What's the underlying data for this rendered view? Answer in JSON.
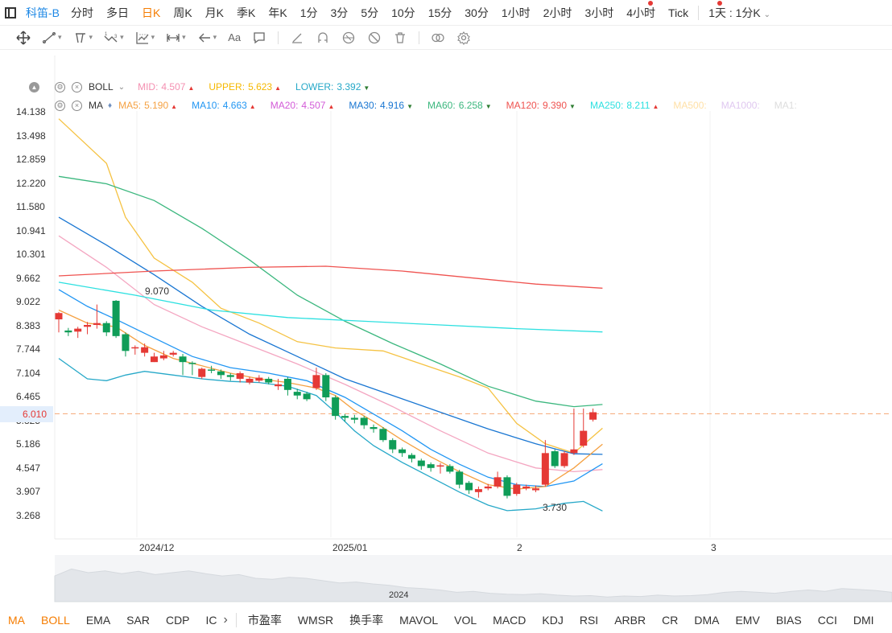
{
  "symbol": "科笛-B",
  "periods": [
    "分时",
    "多日",
    "日K",
    "周K",
    "月K",
    "季K",
    "年K",
    "1分",
    "3分",
    "5分",
    "10分",
    "15分",
    "30分",
    "1小时",
    "2小时",
    "3小时",
    "4小时",
    "Tick"
  ],
  "active_period": "日K",
  "interval_select": "1天 : 1分K",
  "toolbar": {
    "text_tool_label": "Aa"
  },
  "boll": {
    "name": "BOLL",
    "items": [
      {
        "label": "MID:",
        "value": "4.507",
        "color": "#f48fb1",
        "dir": "up"
      },
      {
        "label": "UPPER:",
        "value": "5.623",
        "color": "#f5b800",
        "dir": "up"
      },
      {
        "label": "LOWER:",
        "value": "3.392",
        "color": "#26a8c8",
        "dir": "down"
      }
    ]
  },
  "ma": {
    "name": "MA",
    "items": [
      {
        "label": "MA5:",
        "value": "5.190",
        "color": "#f5a142",
        "dir": "up"
      },
      {
        "label": "MA10:",
        "value": "4.663",
        "color": "#2196f3",
        "dir": "up"
      },
      {
        "label": "MA20:",
        "value": "4.507",
        "color": "#d35bd8",
        "dir": "up"
      },
      {
        "label": "MA30:",
        "value": "4.916",
        "color": "#1976d2",
        "dir": "down"
      },
      {
        "label": "MA60:",
        "value": "6.258",
        "color": "#3bb77e",
        "dir": "down"
      },
      {
        "label": "MA120:",
        "value": "9.390",
        "color": "#ef5350",
        "dir": "down"
      },
      {
        "label": "MA250:",
        "value": "8.211",
        "color": "#2ce0e0",
        "dir": "up"
      },
      {
        "label": "MA500:",
        "value": "",
        "color": "#ffe0a6",
        "dir": ""
      },
      {
        "label": "MA1000:",
        "value": "",
        "color": "#e0c8f0",
        "dir": ""
      },
      {
        "label": "MA1:",
        "value": "",
        "color": "#dddddd",
        "dir": ""
      }
    ]
  },
  "price_ticks": [
    "14.138",
    "13.498",
    "12.859",
    "12.220",
    "11.580",
    "10.941",
    "10.301",
    "9.662",
    "9.022",
    "8.383",
    "7.744",
    "7.104",
    "6.465",
    "5.825",
    "5.186",
    "4.547",
    "3.907",
    "3.268"
  ],
  "current_price": "6.010",
  "annotations": {
    "high": "9.070",
    "low": "3.730"
  },
  "x_labels": [
    "2024/12",
    "2025/01",
    "2",
    "3"
  ],
  "navigator_label": "2024",
  "indicator_tabs": [
    "MA",
    "BOLL",
    "EMA",
    "SAR",
    "CDP",
    "IC",
    "市盈率",
    "WMSR",
    "换手率",
    "MAVOL",
    "VOL",
    "MACD",
    "KDJ",
    "RSI",
    "ARBR",
    "CR",
    "DMA",
    "EMV",
    "BIAS",
    "CCI",
    "DMI"
  ],
  "active_indicators": [
    "MA",
    "BOLL"
  ],
  "colors": {
    "up": "#e53935",
    "down": "#0f9d58",
    "accent": "#f57c00",
    "link": "#1e88e5"
  },
  "chart_data": {
    "type": "candlestick",
    "price_ylim": [
      3.268,
      14.138
    ],
    "candles": [
      {
        "o": 8.55,
        "c": 8.72,
        "h": 8.75,
        "l": 8.2
      },
      {
        "o": 8.25,
        "c": 8.2,
        "h": 8.32,
        "l": 8.1
      },
      {
        "o": 8.22,
        "c": 8.3,
        "h": 8.35,
        "l": 8.05
      },
      {
        "o": 8.35,
        "c": 8.4,
        "h": 8.48,
        "l": 8.15
      },
      {
        "o": 8.4,
        "c": 8.45,
        "h": 8.95,
        "l": 8.3
      },
      {
        "o": 8.45,
        "c": 8.2,
        "h": 8.5,
        "l": 8.1
      },
      {
        "o": 9.05,
        "c": 8.1,
        "h": 9.07,
        "l": 8.05
      },
      {
        "o": 8.15,
        "c": 7.7,
        "h": 8.2,
        "l": 7.55
      },
      {
        "o": 7.78,
        "c": 7.8,
        "h": 7.85,
        "l": 7.6
      },
      {
        "o": 7.65,
        "c": 7.8,
        "h": 7.9,
        "l": 7.55
      },
      {
        "o": 7.4,
        "c": 7.55,
        "h": 7.65,
        "l": 7.4
      },
      {
        "o": 7.5,
        "c": 7.58,
        "h": 7.7,
        "l": 7.45
      },
      {
        "o": 7.6,
        "c": 7.65,
        "h": 7.7,
        "l": 7.55
      },
      {
        "o": 7.55,
        "c": 7.4,
        "h": 7.62,
        "l": 7.05
      },
      {
        "o": 7.38,
        "c": 7.35,
        "h": 7.42,
        "l": 7.05
      },
      {
        "o": 7.0,
        "c": 7.22,
        "h": 7.25,
        "l": 6.95
      },
      {
        "o": 7.2,
        "c": 7.18,
        "h": 7.3,
        "l": 7.1
      },
      {
        "o": 7.15,
        "c": 7.05,
        "h": 7.2,
        "l": 6.95
      },
      {
        "o": 7.05,
        "c": 7.0,
        "h": 7.1,
        "l": 6.9
      },
      {
        "o": 6.95,
        "c": 7.1,
        "h": 7.15,
        "l": 6.85
      },
      {
        "o": 6.85,
        "c": 6.95,
        "h": 7.0,
        "l": 6.8
      },
      {
        "o": 6.9,
        "c": 6.98,
        "h": 7.05,
        "l": 6.85
      },
      {
        "o": 6.95,
        "c": 6.85,
        "h": 7.0,
        "l": 6.8
      },
      {
        "o": 6.75,
        "c": 6.8,
        "h": 6.95,
        "l": 6.65
      },
      {
        "o": 6.95,
        "c": 6.65,
        "h": 7.0,
        "l": 6.5
      },
      {
        "o": 6.6,
        "c": 6.5,
        "h": 6.68,
        "l": 6.4
      },
      {
        "o": 6.55,
        "c": 6.4,
        "h": 6.6,
        "l": 6.35
      },
      {
        "o": 6.7,
        "c": 7.05,
        "h": 7.25,
        "l": 6.65
      },
      {
        "o": 7.05,
        "c": 6.45,
        "h": 7.1,
        "l": 6.35
      },
      {
        "o": 6.45,
        "c": 5.95,
        "h": 6.5,
        "l": 5.85
      },
      {
        "o": 5.95,
        "c": 5.9,
        "h": 6.0,
        "l": 5.8
      },
      {
        "o": 5.9,
        "c": 5.85,
        "h": 5.98,
        "l": 5.75
      },
      {
        "o": 5.9,
        "c": 5.7,
        "h": 5.95,
        "l": 5.6
      },
      {
        "o": 5.65,
        "c": 5.6,
        "h": 5.72,
        "l": 5.5
      },
      {
        "o": 5.6,
        "c": 5.3,
        "h": 5.65,
        "l": 5.25
      },
      {
        "o": 5.3,
        "c": 5.05,
        "h": 5.35,
        "l": 4.95
      },
      {
        "o": 5.05,
        "c": 4.95,
        "h": 5.1,
        "l": 4.85
      },
      {
        "o": 4.9,
        "c": 4.8,
        "h": 4.95,
        "l": 4.7
      },
      {
        "o": 4.75,
        "c": 4.6,
        "h": 4.8,
        "l": 4.5
      },
      {
        "o": 4.65,
        "c": 4.55,
        "h": 4.7,
        "l": 4.45
      },
      {
        "o": 4.6,
        "c": 4.62,
        "h": 4.68,
        "l": 4.4
      },
      {
        "o": 4.6,
        "c": 4.45,
        "h": 4.65,
        "l": 4.4
      },
      {
        "o": 4.45,
        "c": 4.1,
        "h": 4.5,
        "l": 4.0
      },
      {
        "o": 4.15,
        "c": 3.95,
        "h": 4.2,
        "l": 3.85
      },
      {
        "o": 3.9,
        "c": 3.98,
        "h": 4.05,
        "l": 3.75
      },
      {
        "o": 4.0,
        "c": 4.05,
        "h": 4.12,
        "l": 3.95
      },
      {
        "o": 4.05,
        "c": 4.3,
        "h": 4.45,
        "l": 4.0
      },
      {
        "o": 4.3,
        "c": 3.8,
        "h": 4.35,
        "l": 3.73
      },
      {
        "o": 3.85,
        "c": 4.1,
        "h": 4.15,
        "l": 3.8
      },
      {
        "o": 4.0,
        "c": 4.05,
        "h": 4.1,
        "l": 3.95
      },
      {
        "o": 3.95,
        "c": 4.0,
        "h": 4.08,
        "l": 3.9
      },
      {
        "o": 4.1,
        "c": 4.95,
        "h": 5.3,
        "l": 4.05
      },
      {
        "o": 5.0,
        "c": 4.6,
        "h": 5.05,
        "l": 4.55
      },
      {
        "o": 4.6,
        "c": 4.95,
        "h": 5.0,
        "l": 4.55
      },
      {
        "o": 4.95,
        "c": 5.05,
        "h": 6.15,
        "l": 4.9
      },
      {
        "o": 5.15,
        "c": 5.55,
        "h": 6.15,
        "l": 5.1
      },
      {
        "o": 5.85,
        "c": 6.05,
        "h": 6.15,
        "l": 5.8
      }
    ],
    "series": [
      {
        "name": "BOLL UPPER",
        "color": "#f5c242",
        "values": [
          [
            0,
            13.95
          ],
          [
            5,
            12.75
          ],
          [
            7,
            11.3
          ],
          [
            10,
            10.2
          ],
          [
            14,
            9.55
          ],
          [
            17,
            8.85
          ],
          [
            21,
            8.45
          ],
          [
            25,
            7.95
          ],
          [
            29,
            7.78
          ],
          [
            34,
            7.7
          ],
          [
            38,
            7.35
          ],
          [
            42,
            7.0
          ],
          [
            45,
            6.7
          ],
          [
            48,
            5.75
          ],
          [
            51,
            5.2
          ],
          [
            54,
            4.95
          ],
          [
            57,
            5.62
          ]
        ]
      },
      {
        "name": "MA60",
        "color": "#3bb77e",
        "values": [
          [
            0,
            12.4
          ],
          [
            5,
            12.2
          ],
          [
            10,
            11.75
          ],
          [
            15,
            11.0
          ],
          [
            20,
            10.15
          ],
          [
            25,
            9.2
          ],
          [
            30,
            8.5
          ],
          [
            35,
            7.9
          ],
          [
            40,
            7.35
          ],
          [
            45,
            6.75
          ],
          [
            50,
            6.35
          ],
          [
            54,
            6.2
          ],
          [
            57,
            6.258
          ]
        ]
      },
      {
        "name": "MA30",
        "color": "#1976d2",
        "values": [
          [
            0,
            11.3
          ],
          [
            5,
            10.55
          ],
          [
            10,
            9.75
          ],
          [
            15,
            8.9
          ],
          [
            20,
            8.15
          ],
          [
            25,
            7.55
          ],
          [
            30,
            6.95
          ],
          [
            35,
            6.5
          ],
          [
            40,
            6.05
          ],
          [
            45,
            5.6
          ],
          [
            50,
            5.2
          ],
          [
            54,
            4.93
          ],
          [
            57,
            4.916
          ]
        ]
      },
      {
        "name": "MA20",
        "color": "#f4a6c1",
        "values": [
          [
            0,
            10.8
          ],
          [
            5,
            9.95
          ],
          [
            10,
            8.95
          ],
          [
            15,
            8.35
          ],
          [
            20,
            7.85
          ],
          [
            25,
            7.35
          ],
          [
            30,
            6.8
          ],
          [
            35,
            6.2
          ],
          [
            40,
            5.55
          ],
          [
            45,
            4.95
          ],
          [
            50,
            4.55
          ],
          [
            54,
            4.45
          ],
          [
            57,
            4.507
          ]
        ]
      },
      {
        "name": "MA120",
        "color": "#ef5350",
        "values": [
          [
            0,
            9.72
          ],
          [
            10,
            9.85
          ],
          [
            20,
            9.95
          ],
          [
            28,
            9.98
          ],
          [
            36,
            9.85
          ],
          [
            44,
            9.65
          ],
          [
            50,
            9.5
          ],
          [
            57,
            9.39
          ]
        ]
      },
      {
        "name": "MA250",
        "color": "#2ce0e0",
        "values": [
          [
            0,
            9.55
          ],
          [
            8,
            9.2
          ],
          [
            16,
            8.8
          ],
          [
            24,
            8.6
          ],
          [
            32,
            8.5
          ],
          [
            40,
            8.4
          ],
          [
            48,
            8.3
          ],
          [
            57,
            8.211
          ]
        ]
      },
      {
        "name": "MA10",
        "color": "#2196f3",
        "values": [
          [
            0,
            9.35
          ],
          [
            3,
            8.9
          ],
          [
            6,
            8.55
          ],
          [
            10,
            8.05
          ],
          [
            14,
            7.55
          ],
          [
            18,
            7.25
          ],
          [
            22,
            7.1
          ],
          [
            26,
            6.9
          ],
          [
            30,
            6.45
          ],
          [
            33,
            6.0
          ],
          [
            36,
            5.55
          ],
          [
            39,
            5.05
          ],
          [
            42,
            4.65
          ],
          [
            45,
            4.3
          ],
          [
            48,
            4.1
          ],
          [
            51,
            4.05
          ],
          [
            54,
            4.2
          ],
          [
            57,
            4.663
          ]
        ]
      },
      {
        "name": "MA5",
        "color": "#f5a142",
        "values": [
          [
            0,
            8.8
          ],
          [
            3,
            8.45
          ],
          [
            6,
            8.35
          ],
          [
            9,
            7.85
          ],
          [
            12,
            7.5
          ],
          [
            15,
            7.3
          ],
          [
            18,
            7.1
          ],
          [
            21,
            6.95
          ],
          [
            24,
            6.85
          ],
          [
            27,
            6.7
          ],
          [
            29,
            6.5
          ],
          [
            31,
            6.1
          ],
          [
            33,
            5.8
          ],
          [
            36,
            5.3
          ],
          [
            39,
            4.85
          ],
          [
            42,
            4.45
          ],
          [
            45,
            4.1
          ],
          [
            48,
            3.98
          ],
          [
            51,
            4.05
          ],
          [
            54,
            4.55
          ],
          [
            57,
            5.19
          ]
        ]
      },
      {
        "name": "BOLL LOWER",
        "color": "#26a8c8",
        "values": [
          [
            0,
            7.5
          ],
          [
            3,
            6.95
          ],
          [
            5,
            6.9
          ],
          [
            7,
            7.05
          ],
          [
            9,
            7.15
          ],
          [
            12,
            7.05
          ],
          [
            15,
            6.95
          ],
          [
            18,
            6.88
          ],
          [
            21,
            6.85
          ],
          [
            24,
            6.75
          ],
          [
            27,
            6.5
          ],
          [
            29,
            6.05
          ],
          [
            31,
            5.55
          ],
          [
            33,
            5.15
          ],
          [
            36,
            4.7
          ],
          [
            39,
            4.3
          ],
          [
            42,
            3.9
          ],
          [
            45,
            3.55
          ],
          [
            47,
            3.4
          ],
          [
            50,
            3.45
          ],
          [
            53,
            3.6
          ],
          [
            55,
            3.65
          ],
          [
            57,
            3.392
          ]
        ]
      }
    ],
    "navigator": [
      0.55,
      0.7,
      0.62,
      0.66,
      0.6,
      0.65,
      0.58,
      0.62,
      0.66,
      0.6,
      0.55,
      0.58,
      0.5,
      0.48,
      0.52,
      0.5,
      0.45,
      0.4,
      0.42,
      0.38,
      0.35,
      0.3,
      0.28,
      0.25,
      0.2,
      0.22,
      0.18,
      0.16,
      0.15,
      0.17,
      0.14,
      0.12,
      0.13,
      0.1,
      0.12,
      0.11,
      0.14,
      0.12,
      0.13,
      0.15,
      0.2,
      0.22,
      0.2,
      0.18,
      0.22,
      0.25,
      0.22,
      0.28,
      0.26,
      0.24,
      0.2
    ]
  }
}
